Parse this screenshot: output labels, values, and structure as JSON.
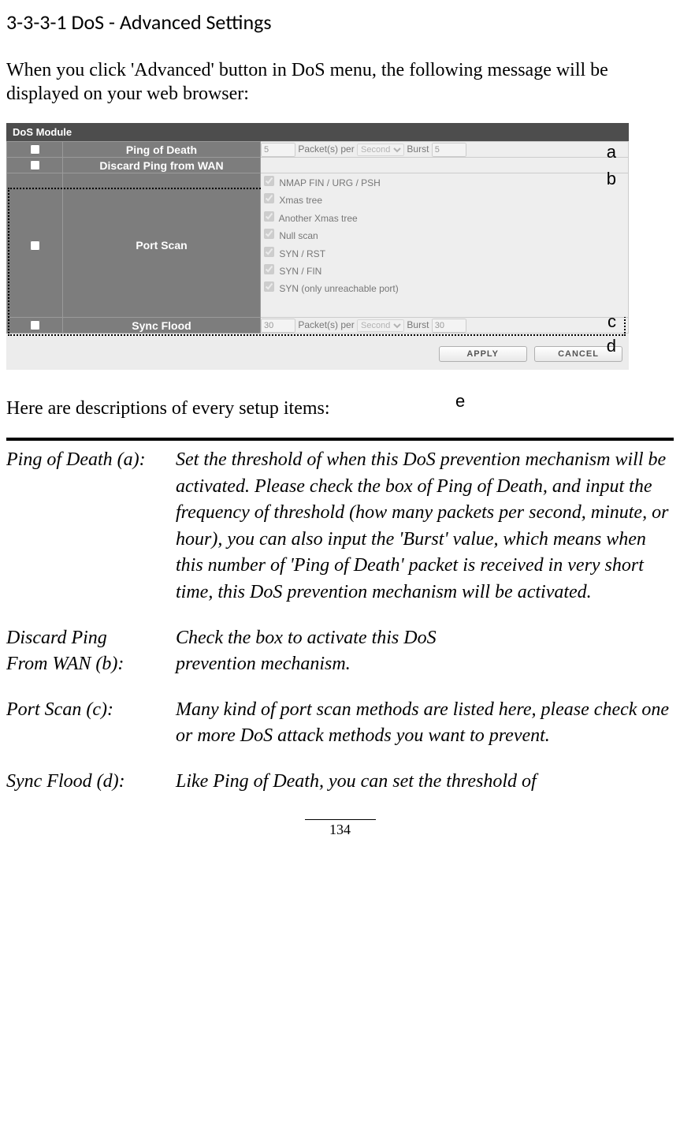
{
  "heading": "3-3-3-1 DoS - Advanced Settings",
  "intro": "When you click 'Advanced' button in DoS menu, the following message will be displayed on your web browser:",
  "after_shot": "Here are descriptions of every setup items:",
  "page_number": "134",
  "shot": {
    "header": "DoS Module",
    "rows": {
      "ping": {
        "label": "Ping of Death",
        "packets_value": "5",
        "packets_label": " Packet(s) per ",
        "unit_value": "Second",
        "burst_label": "  Burst ",
        "burst_value": "5",
        "annot": "a"
      },
      "discard": {
        "label": "Discard Ping from WAN",
        "annot": "b"
      },
      "portscan": {
        "label": "Port Scan",
        "items": [
          "NMAP FIN / URG / PSH",
          "Xmas tree",
          "Another Xmas tree",
          "Null scan",
          "SYN / RST",
          "SYN / FIN",
          "SYN (only unreachable port)"
        ],
        "annot": "c"
      },
      "sync": {
        "label": "Sync Flood",
        "packets_value": "30",
        "packets_label": " Packet(s) per ",
        "unit_value": "Second",
        "burst_label": "  Burst ",
        "burst_value": "30",
        "annot": "d"
      }
    },
    "buttons": {
      "apply": "APPLY",
      "cancel": "CANCEL",
      "annot": "e"
    }
  },
  "defs": {
    "ping": {
      "term": "Ping of Death (a):",
      "desc": "Set the threshold of when this DoS prevention mechanism will be activated. Please check the box of Ping of Death, and input the frequency of threshold (how many packets per second, minute, or hour), you can also input the 'Burst' value, which means when this number of 'Ping of Death' packet is received in very short time, this DoS prevention mechanism will be activated."
    },
    "discard": {
      "term1": "Discard Ping",
      "term2": "From WAN (b):",
      "desc1": "Check the box to activate this DoS",
      "desc2": "prevention mechanism."
    },
    "portscan": {
      "term": "Port Scan (c):",
      "desc": "Many kind of port scan methods are listed here, please check one or more DoS attack methods you want to prevent."
    },
    "sync": {
      "term": "Sync Flood (d):",
      "desc": "Like Ping of Death, you can set the threshold of"
    }
  }
}
